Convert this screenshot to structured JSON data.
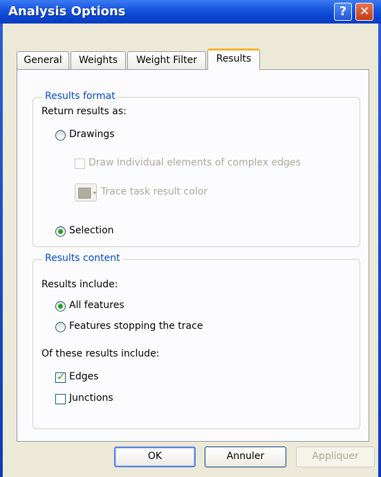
{
  "window": {
    "title": "Analysis Options",
    "help_glyph": "?",
    "close_glyph": "✕"
  },
  "tabs": [
    {
      "label": "General",
      "active": false
    },
    {
      "label": "Weights",
      "active": false
    },
    {
      "label": "Weight Filter",
      "active": false
    },
    {
      "label": "Results",
      "active": true
    }
  ],
  "results_format": {
    "legend": "Results format",
    "return_as_label": "Return results as:",
    "drawings_label": "Drawings",
    "drawings_selected": false,
    "draw_individual_label": "Draw individual elements of complex edges",
    "draw_individual_checked": false,
    "trace_color_label": "Trace task result color",
    "selection_label": "Selection",
    "selection_selected": true
  },
  "results_content": {
    "legend": "Results content",
    "include_label": "Results include:",
    "all_features_label": "All features",
    "all_features_selected": true,
    "stopping_label": "Features stopping the trace",
    "stopping_selected": false,
    "of_these_label": "Of these results include:",
    "edges_label": "Edges",
    "edges_checked": true,
    "junctions_label": "Junctions",
    "junctions_checked": false,
    "check_glyph": "✓"
  },
  "buttons": {
    "ok": "OK",
    "cancel": "Annuler",
    "apply": "Appliquer"
  },
  "colors": {
    "accent_blue": "#0046d5",
    "radio_green": "#21a121",
    "tab_highlight": "#f7b531"
  }
}
